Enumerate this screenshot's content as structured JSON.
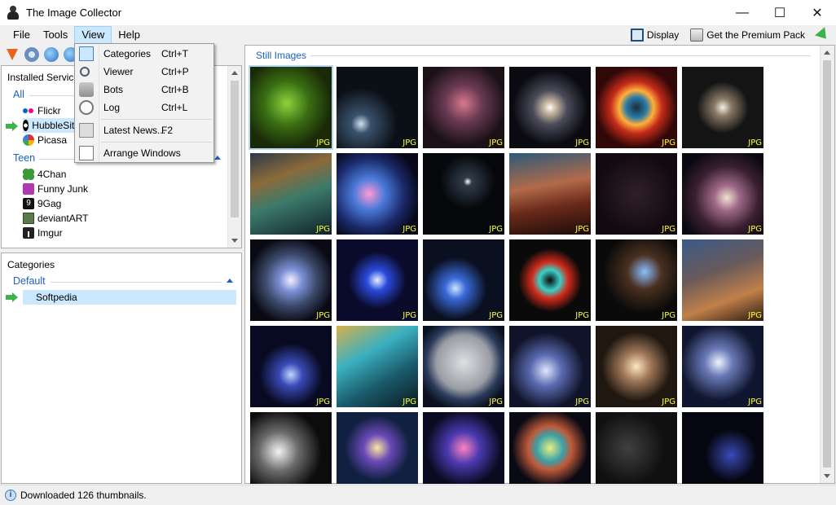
{
  "window": {
    "title": "The Image Collector",
    "controls": [
      "—",
      "☐",
      "✕"
    ]
  },
  "menubar": {
    "items": [
      "File",
      "Tools",
      "View",
      "Help"
    ],
    "active": "View"
  },
  "topright": {
    "display_label": "Display",
    "premium_label": "Get the Premium Pack"
  },
  "services_panel": {
    "heading": "Installed Services",
    "groups": [
      {
        "name": "All",
        "items": [
          "Flickr",
          "HubbleSite",
          "Picasa"
        ],
        "selected": "HubbleSite"
      },
      {
        "name": "Teen",
        "items": [
          "4Chan",
          "Funny Junk",
          "9Gag",
          "deviantART",
          "Imgur"
        ]
      }
    ]
  },
  "categories_panel": {
    "heading": "Categories",
    "group": "Default",
    "items": [
      "Softpedia"
    ]
  },
  "images_panel": {
    "section_label": "Still Images",
    "badge": "JPG",
    "rows_visible": 5,
    "cols": 6
  },
  "view_menu": {
    "items": [
      {
        "label": "Categories",
        "shortcut": "Ctrl+T",
        "icon": "categories-icon",
        "checked": true
      },
      {
        "label": "Viewer",
        "shortcut": "Ctrl+P",
        "icon": "magnifier-icon"
      },
      {
        "label": "Bots",
        "shortcut": "Ctrl+B",
        "icon": "bot-icon"
      },
      {
        "label": "Log",
        "shortcut": "Ctrl+L",
        "icon": "log-icon"
      },
      {
        "label": "Latest News...",
        "shortcut": "F2",
        "icon": "news-icon"
      },
      {
        "label": "Arrange Windows",
        "shortcut": "",
        "icon": "windows-icon"
      }
    ]
  },
  "status": {
    "text": "Downloaded 126 thumbnails."
  },
  "colors": {
    "accent": "#1b60c4",
    "selection": "#cce8ff",
    "badge": "#ffff3c"
  }
}
